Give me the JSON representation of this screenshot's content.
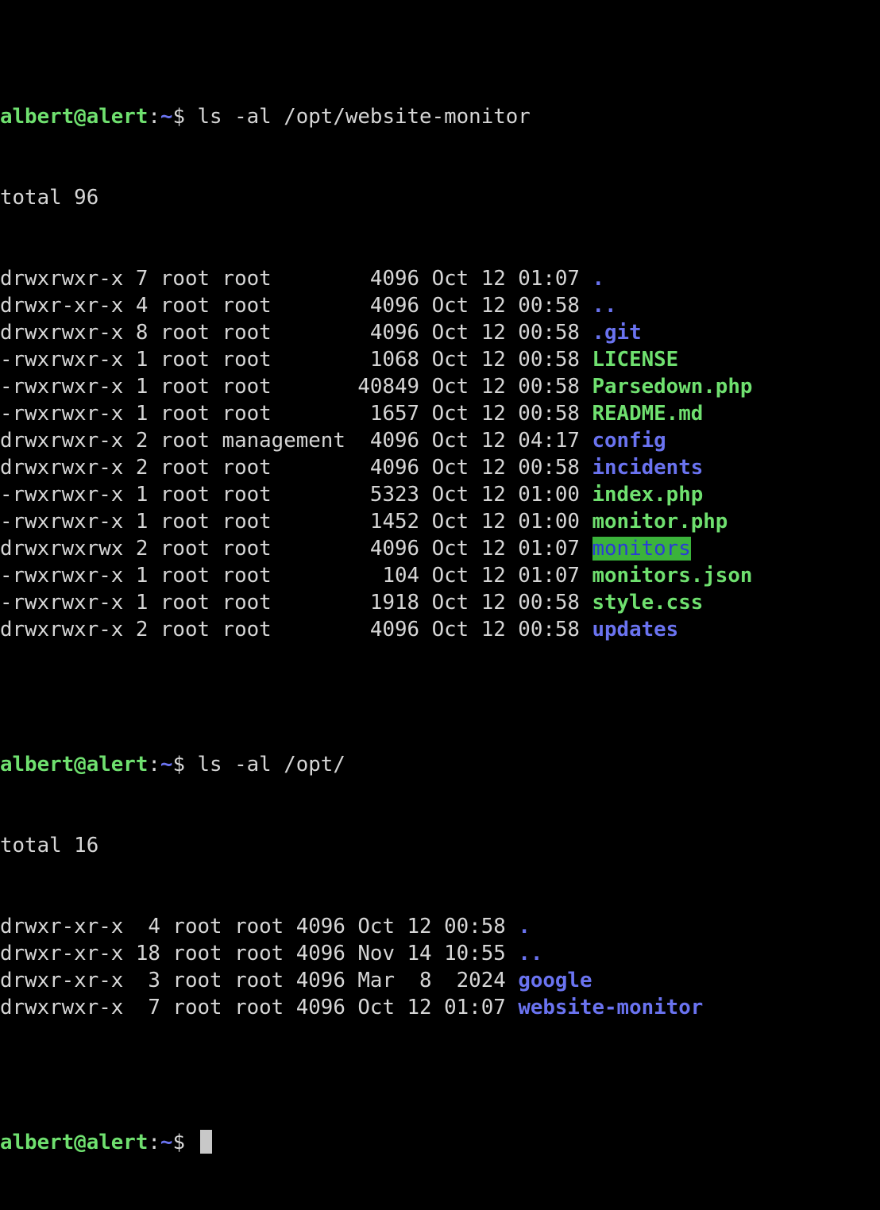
{
  "prompt": {
    "user_host": "albert@alert",
    "sep": ":",
    "path": "~",
    "sigil": "$ "
  },
  "commands": {
    "first": "ls -al /opt/website-monitor",
    "second": "ls -al /opt/"
  },
  "listing1": {
    "total": "total 96",
    "rows": [
      {
        "meta": "drwxrwxr-x 7 root root        4096 Oct 12 01:07 ",
        "name": ".",
        "kind": "dir"
      },
      {
        "meta": "drwxr-xr-x 4 root root        4096 Oct 12 00:58 ",
        "name": "..",
        "kind": "dir"
      },
      {
        "meta": "drwxrwxr-x 8 root root        4096 Oct 12 00:58 ",
        "name": ".git",
        "kind": "dir"
      },
      {
        "meta": "-rwxrwxr-x 1 root root        1068 Oct 12 00:58 ",
        "name": "LICENSE",
        "kind": "exec"
      },
      {
        "meta": "-rwxrwxr-x 1 root root       40849 Oct 12 00:58 ",
        "name": "Parsedown.php",
        "kind": "exec"
      },
      {
        "meta": "-rwxrwxr-x 1 root root        1657 Oct 12 00:58 ",
        "name": "README.md",
        "kind": "exec"
      },
      {
        "meta": "drwxrwxr-x 2 root management  4096 Oct 12 04:17 ",
        "name": "config",
        "kind": "dir"
      },
      {
        "meta": "drwxrwxr-x 2 root root        4096 Oct 12 00:58 ",
        "name": "incidents",
        "kind": "dir"
      },
      {
        "meta": "-rwxrwxr-x 1 root root        5323 Oct 12 01:00 ",
        "name": "index.php",
        "kind": "exec"
      },
      {
        "meta": "-rwxrwxr-x 1 root root        1452 Oct 12 01:00 ",
        "name": "monitor.php",
        "kind": "exec"
      },
      {
        "meta": "drwxrwxrwx 2 root root        4096 Oct 12 01:07 ",
        "name": "monitors",
        "kind": "ow"
      },
      {
        "meta": "-rwxrwxr-x 1 root root         104 Oct 12 01:07 ",
        "name": "monitors.json",
        "kind": "exec"
      },
      {
        "meta": "-rwxrwxr-x 1 root root        1918 Oct 12 00:58 ",
        "name": "style.css",
        "kind": "exec"
      },
      {
        "meta": "drwxrwxr-x 2 root root        4096 Oct 12 00:58 ",
        "name": "updates",
        "kind": "dir"
      }
    ]
  },
  "listing2": {
    "total": "total 16",
    "rows": [
      {
        "meta": "drwxr-xr-x  4 root root 4096 Oct 12 00:58 ",
        "name": ".",
        "kind": "dir"
      },
      {
        "meta": "drwxr-xr-x 18 root root 4096 Nov 14 10:55 ",
        "name": "..",
        "kind": "dir"
      },
      {
        "meta": "drwxr-xr-x  3 root root 4096 Mar  8  2024 ",
        "name": "google",
        "kind": "dir"
      },
      {
        "meta": "drwxrwxr-x  7 root root 4096 Oct 12 01:07 ",
        "name": "website-monitor",
        "kind": "dir"
      }
    ]
  }
}
